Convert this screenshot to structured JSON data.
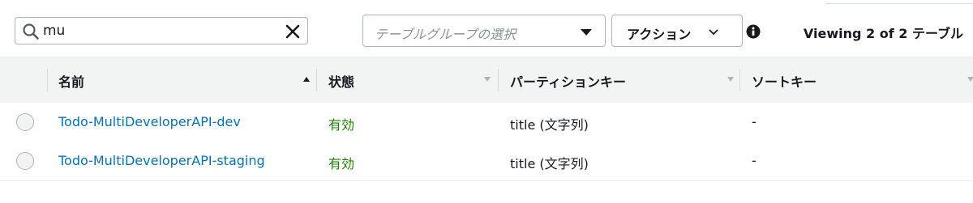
{
  "toolbar": {
    "search_value": "mu",
    "table_group_placeholder": "テーブルグループの選択",
    "actions_label": "アクション",
    "viewing_text": "Viewing 2 of 2 テーブル"
  },
  "columns": [
    {
      "label": "名前",
      "sort": "ascending"
    },
    {
      "label": "状態",
      "sort": "none"
    },
    {
      "label": "パーティションキー",
      "sort": "none"
    },
    {
      "label": "ソートキー",
      "sort": "none"
    }
  ],
  "rows": [
    {
      "name": "Todo-MultiDeveloperAPI-dev",
      "status": "有効",
      "partition_key": "title (文字列)",
      "sort_key": "-"
    },
    {
      "name": "Todo-MultiDeveloperAPI-staging",
      "status": "有効",
      "partition_key": "title (文字列)",
      "sort_key": "-"
    }
  ],
  "colors": {
    "link": "#0073bb",
    "status_ok": "#1d8102",
    "header_bg": "#f2f3f3"
  },
  "icons": [
    "search-icon",
    "clear-icon",
    "dropdown-caret-icon",
    "chevron-down-icon",
    "info-icon",
    "sort-up-icon",
    "sort-down-icon"
  ]
}
